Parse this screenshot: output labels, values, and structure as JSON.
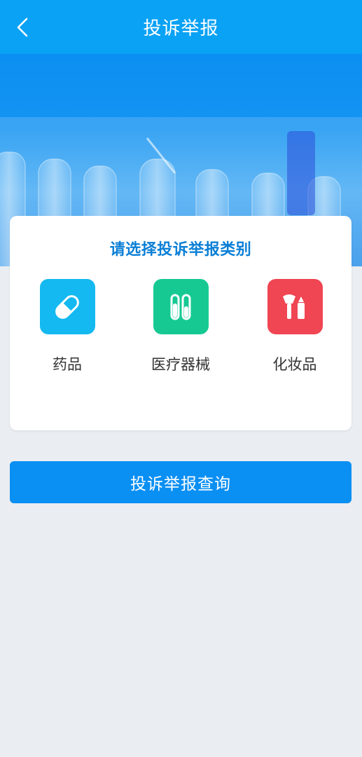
{
  "header": {
    "title": "投诉举报",
    "back_icon": "chevron-left-icon"
  },
  "banner": {
    "image": "lab-test-tubes-banner"
  },
  "card": {
    "title": "请选择投诉举报类别",
    "categories": [
      {
        "label": "药品",
        "icon": "pill-icon",
        "color": "#13b9f0"
      },
      {
        "label": "医疗器械",
        "icon": "test-tubes-icon",
        "color": "#16c993"
      },
      {
        "label": "化妆品",
        "icon": "cosmetics-icon",
        "color": "#f04552"
      }
    ]
  },
  "query_button": {
    "label": "投诉举报查询"
  },
  "colors": {
    "primary": "#0a8ff3",
    "header": "#0aa2f5",
    "title": "#0b7fd6",
    "background": "#eaedf1"
  }
}
